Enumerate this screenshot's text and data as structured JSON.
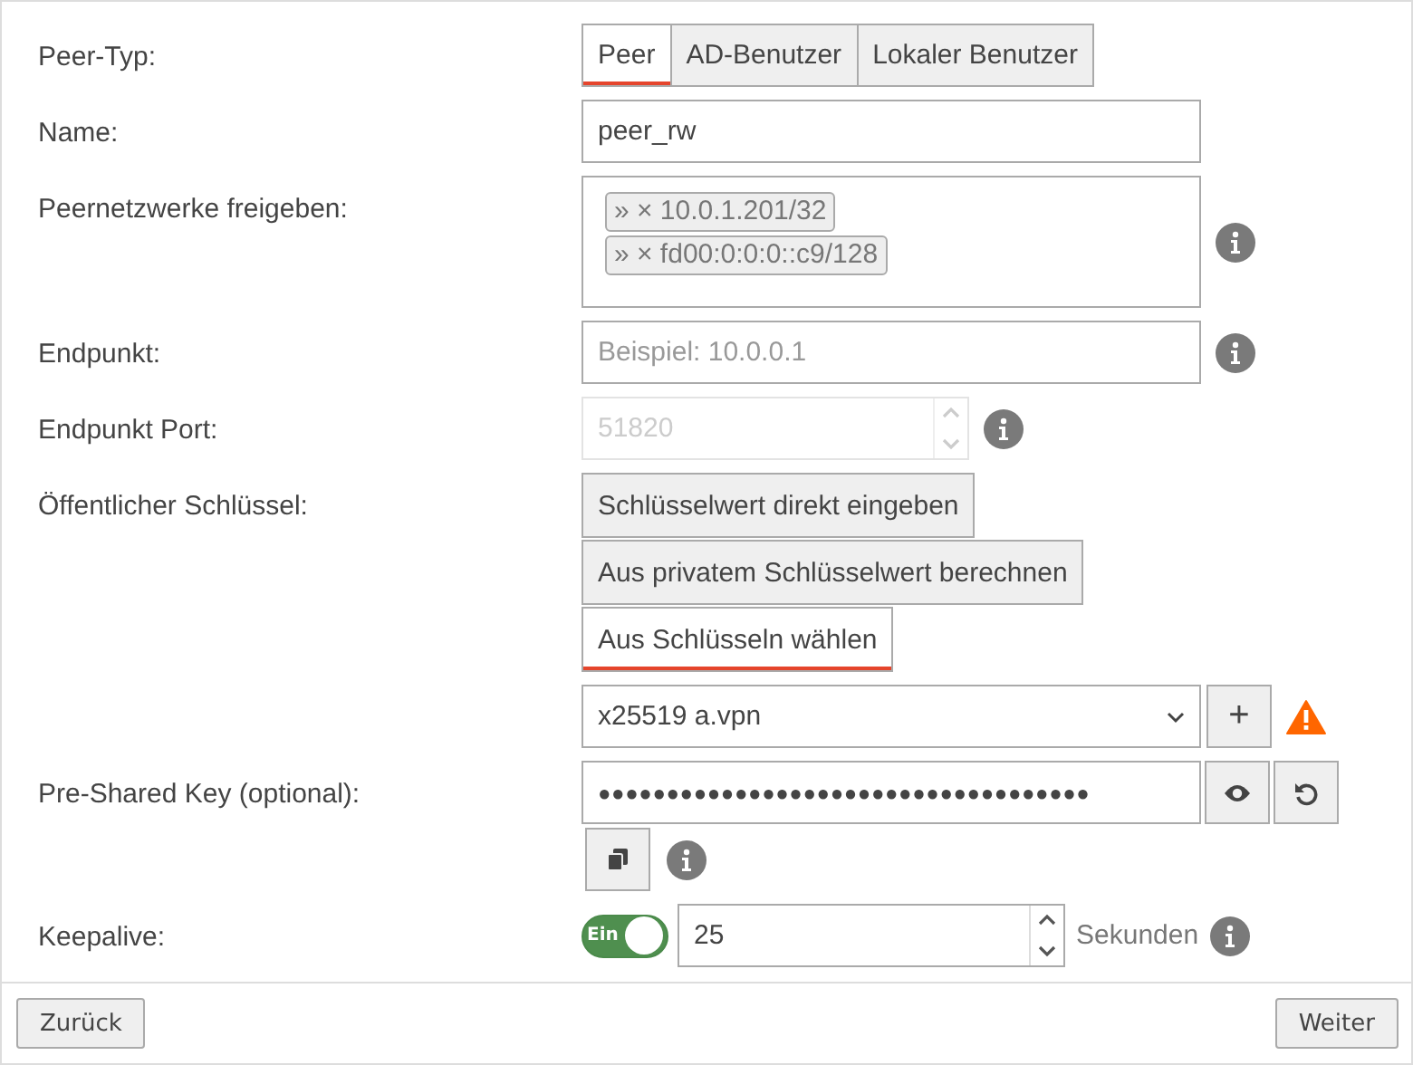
{
  "fields": [
    {
      "kind": "tabs",
      "label": "Peer-Typ:",
      "tabs": [
        {
          "label": "Peer",
          "selected": true
        },
        {
          "label": "AD-Benutzer",
          "selected": false
        },
        {
          "label": "Lokaler Benutzer",
          "selected": false
        }
      ]
    },
    {
      "kind": "text",
      "label": "Name:",
      "value": "peer_rw"
    },
    {
      "kind": "tags",
      "label": "Peernetzwerke freigeben:",
      "info": true,
      "tags": [
        {
          "handle": "»",
          "remove": "×",
          "value": "10.0.1.201/32"
        },
        {
          "handle": "»",
          "remove": "×",
          "value": "fd00:0:0:0::c9/128"
        }
      ]
    },
    {
      "kind": "text",
      "label": "Endpunkt:",
      "placeholder": "Beispiel: 10.0.0.1",
      "info": true
    },
    {
      "kind": "number",
      "label": "Endpunkt Port:",
      "value": "51820",
      "disabled": true,
      "info": true
    },
    {
      "kind": "choice",
      "label": "Öffentlicher Schlüssel:",
      "options": [
        {
          "label": "Schlüsselwert direkt eingeben",
          "selected": false
        },
        {
          "label": "Aus privatem Schlüsselwert berechnen",
          "selected": false
        },
        {
          "label": "Aus Schlüsseln wählen",
          "selected": true
        }
      ]
    },
    {
      "kind": "select",
      "value": "x25519 a.vpn",
      "add": "+",
      "warning": true
    },
    {
      "kind": "password",
      "label": "Pre-Shared Key (optional):",
      "masked": "●●●●●●●●●●●●●●●●●●●●●●●●●●●●●●●●●●●●",
      "info": true
    },
    {
      "kind": "keepalive",
      "label": "Keepalive:",
      "toggle": {
        "on": true,
        "label": "Ein"
      },
      "value": "25",
      "unit": "Sekunden",
      "info": true
    }
  ],
  "footer": {
    "back": "Zurück",
    "next": "Weiter"
  }
}
